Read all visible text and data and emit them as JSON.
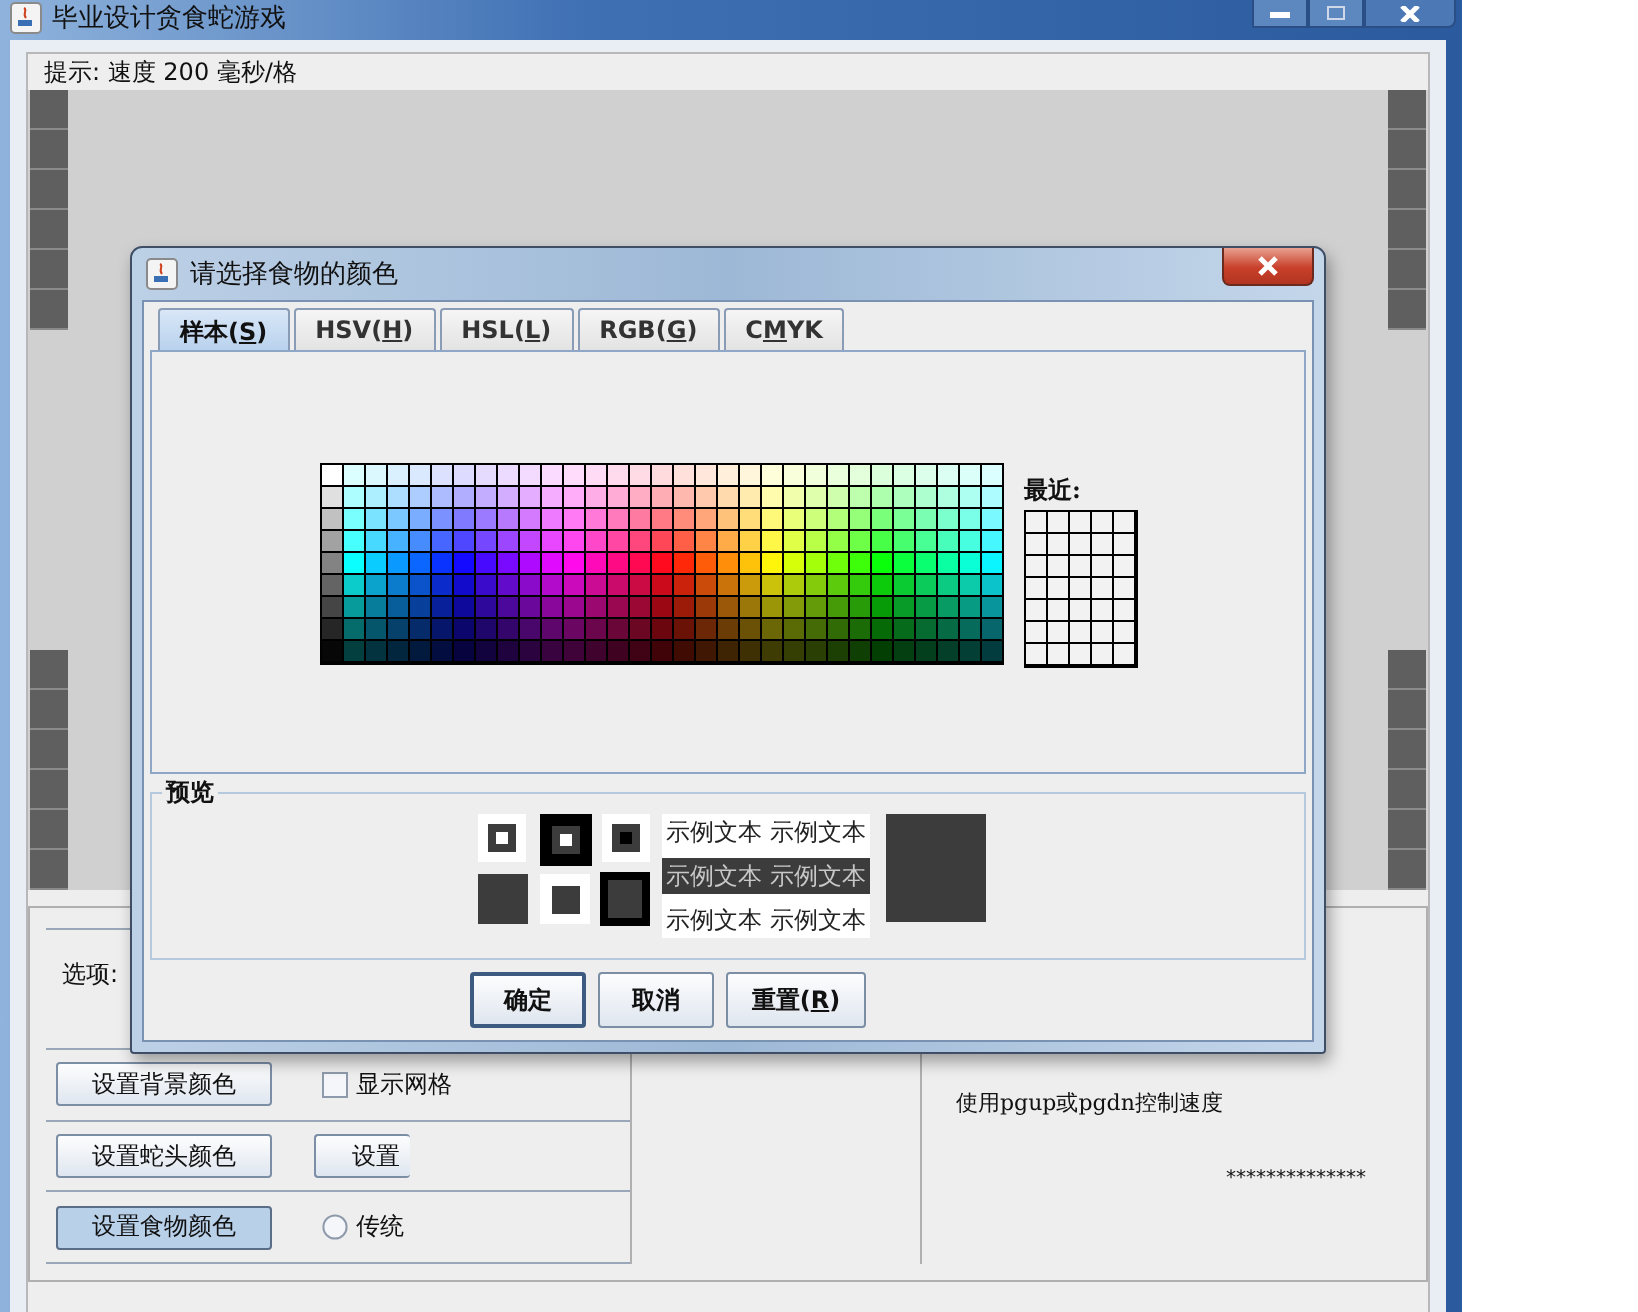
{
  "window": {
    "title": "毕业设计贪食蛇游戏"
  },
  "hint": "提示: 速度 200 毫秒/格",
  "options": {
    "label": "选项:",
    "rows": [
      {
        "button": {
          "label": "设置背景颜色",
          "pressed": false
        },
        "extra": {
          "kind": "checkbox",
          "label": "显示网格",
          "checked": false
        }
      },
      {
        "button": {
          "label": "设置蛇头颜色",
          "pressed": false
        },
        "extra": {
          "kind": "button",
          "label": "设置"
        }
      },
      {
        "button": {
          "label": "设置食物颜色",
          "pressed": true
        },
        "extra": {
          "kind": "radio",
          "label": "传统",
          "selected": false
        }
      }
    ]
  },
  "info": {
    "speed_hint": "使用pgup或pgdn控制速度",
    "masked_text": "**************"
  },
  "dialog": {
    "title": "请选择食物的颜色",
    "tabs": [
      {
        "parts": [
          "样本(",
          "S",
          ")"
        ],
        "selected": true
      },
      {
        "parts": [
          "HSV(",
          "H",
          ")"
        ],
        "selected": false
      },
      {
        "parts": [
          "HSL(",
          "L",
          ")"
        ],
        "selected": false
      },
      {
        "parts": [
          "RGB(",
          "G",
          ")"
        ],
        "selected": false
      },
      {
        "parts": [
          "C",
          "M",
          "YK"
        ],
        "selected": false
      }
    ],
    "recent_label": "最近:",
    "preview": {
      "title": "预览",
      "color": "#3c3c3c",
      "sample_texts": [
        "示例文本 示例文本",
        "示例文本 示例文本",
        "示例文本 示例文本"
      ]
    },
    "buttons": [
      {
        "parts": [
          "确定"
        ]
      },
      {
        "parts": [
          "取消"
        ]
      },
      {
        "parts": [
          "重置(",
          "R",
          ")"
        ]
      }
    ]
  }
}
